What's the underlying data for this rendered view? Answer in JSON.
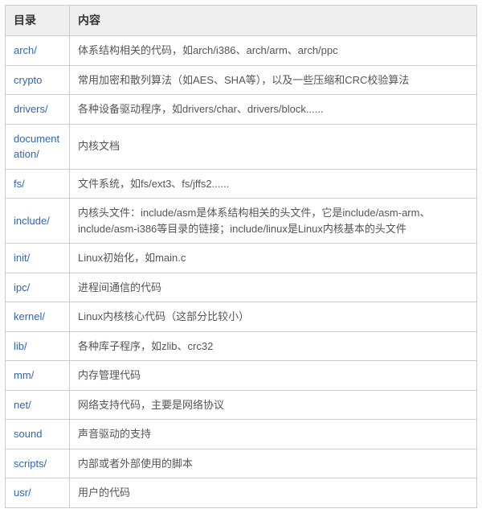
{
  "headers": {
    "col1": "目录",
    "col2": "内容"
  },
  "rows": [
    {
      "dir": "arch/",
      "content": "体系结构相关的代码，如arch/i386、arch/arm、arch/ppc"
    },
    {
      "dir": "crypto",
      "content": "常用加密和散列算法（如AES、SHA等），以及一些压缩和CRC校验算法"
    },
    {
      "dir": "drivers/",
      "content": "各种设备驱动程序，如drivers/char、drivers/block......"
    },
    {
      "dir": "documentation/",
      "content": "内核文档"
    },
    {
      "dir": "fs/",
      "content": "文件系统，如fs/ext3、fs/jffs2......"
    },
    {
      "dir": "include/",
      "content": "内核头文件：include/asm是体系结构相关的头文件，它是include/asm-arm、include/asm-i386等目录的链接；include/linux是Linux内核基本的头文件"
    },
    {
      "dir": "init/",
      "content": "Linux初始化，如main.c"
    },
    {
      "dir": "ipc/",
      "content": "进程间通信的代码"
    },
    {
      "dir": "kernel/",
      "content": "Linux内核核心代码（这部分比较小）"
    },
    {
      "dir": "lib/",
      "content": "各种库子程序，如zlib、crc32"
    },
    {
      "dir": "mm/",
      "content": "内存管理代码"
    },
    {
      "dir": "net/",
      "content": "网络支持代码，主要是网络协议"
    },
    {
      "dir": "sound",
      "content": "声音驱动的支持"
    },
    {
      "dir": "scripts/",
      "content": "内部或者外部使用的脚本"
    },
    {
      "dir": "usr/",
      "content": "用户的代码"
    }
  ]
}
